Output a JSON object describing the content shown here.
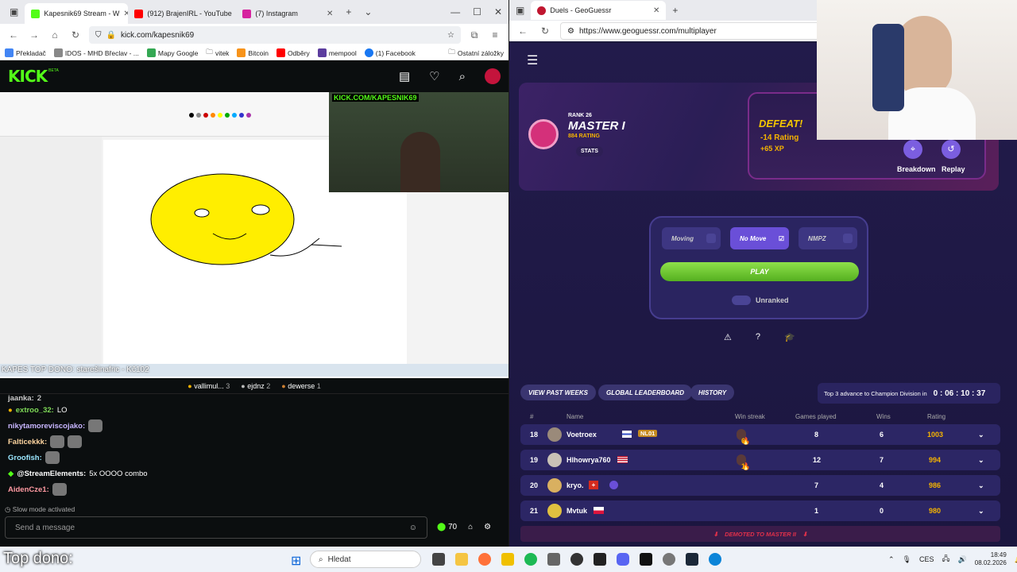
{
  "left_browser": {
    "tabs": [
      {
        "label": "Kapesnik69 Stream - W",
        "color": "#53fc18"
      },
      {
        "label": "(912) BrajenIRL - YouTube",
        "color": "#ff0000"
      },
      {
        "label": "(7) Instagram",
        "color": "#d6249f"
      }
    ],
    "url": "kick.com/kapesnik69",
    "bookmarks": [
      "Překladač",
      "IDOS - MHD Břeclav - ...",
      "Mapy Google",
      "vitek",
      "Bitcoin",
      "Odběry",
      "mempool",
      "(1) Facebook"
    ],
    "other_bookmarks": "Ostatní záložky"
  },
  "kick": {
    "logo": "KICK",
    "beta": "BETA"
  },
  "stream": {
    "overlay_text": "KICK.COM/KAPESNIK69",
    "dono_ticker": "KAPES TOP DONO: starešinafric - Kč102",
    "pinned": [
      {
        "name": "vallimul...",
        "count": "3"
      },
      {
        "name": "ejdnz",
        "count": "2"
      },
      {
        "name": "dewerse",
        "count": "1"
      }
    ]
  },
  "chat": {
    "messages": [
      {
        "user": "jaanka:",
        "text": "2",
        "color": "#ccc"
      },
      {
        "user": "extroo_32:",
        "text": "LO",
        "color": "#7ed957"
      },
      {
        "user": "nikytamoreviscojako:",
        "text": "",
        "color": "#c8b6ff"
      },
      {
        "user": "Falticekkk:",
        "text": "",
        "color": "#ffd6a0"
      },
      {
        "user": "Groofish:",
        "text": "",
        "color": "#9be7ff"
      },
      {
        "user": "@StreamElements:",
        "text": "5x OOOO combo",
        "color": "#ffffff"
      },
      {
        "user": "AidenCze1:",
        "text": "",
        "color": "#ff9aa2"
      }
    ],
    "slow_mode": "Slow mode activated",
    "placeholder": "Send a message",
    "points": "70"
  },
  "right_browser": {
    "tab": "Duels - GeoGuessr",
    "url": "https://www.geoguessr.com/multiplayer"
  },
  "geo": {
    "rank_label": "RANK 26",
    "tier": "MASTER I",
    "rating": "884 RATING",
    "stats": "STATS",
    "result": "DEFEAT!",
    "rating_change": "-14 Rating",
    "xp": "+65 XP",
    "breakdown": "Breakdown",
    "replay": "Replay",
    "modes": [
      "Moving",
      "No Move",
      "NMPZ"
    ],
    "play": "PLAY",
    "unranked": "Unranked",
    "pills": [
      "VIEW PAST WEEKS",
      "GLOBAL LEADERBOARD",
      "HISTORY"
    ],
    "advance_text": "Top 3 advance to Champion Division in",
    "timer": "0 : 06 : 10 : 37",
    "headers": [
      "#",
      "Name",
      "Win streak",
      "Games played",
      "Wins",
      "Rating"
    ],
    "rows": [
      {
        "rank": "18",
        "name": "Voetroex",
        "tag": "NL01",
        "streak": "6",
        "games": "8",
        "wins": "6",
        "rating": "1003"
      },
      {
        "rank": "19",
        "name": "Hlhowrya760",
        "tag": "",
        "streak": "1",
        "games": "12",
        "wins": "7",
        "rating": "994"
      },
      {
        "rank": "20",
        "name": "kryo.",
        "tag": "",
        "streak": "",
        "games": "7",
        "wins": "4",
        "rating": "986"
      },
      {
        "rank": "21",
        "name": "Mvtuk",
        "tag": "",
        "streak": "",
        "games": "1",
        "wins": "0",
        "rating": "980"
      }
    ],
    "demoted": "DEMOTED TO MASTER II"
  },
  "taskbar": {
    "search": "Hledat",
    "lang": "CES",
    "time": "18:49",
    "date": "08.02.2026",
    "overlay": "Top dono:"
  }
}
